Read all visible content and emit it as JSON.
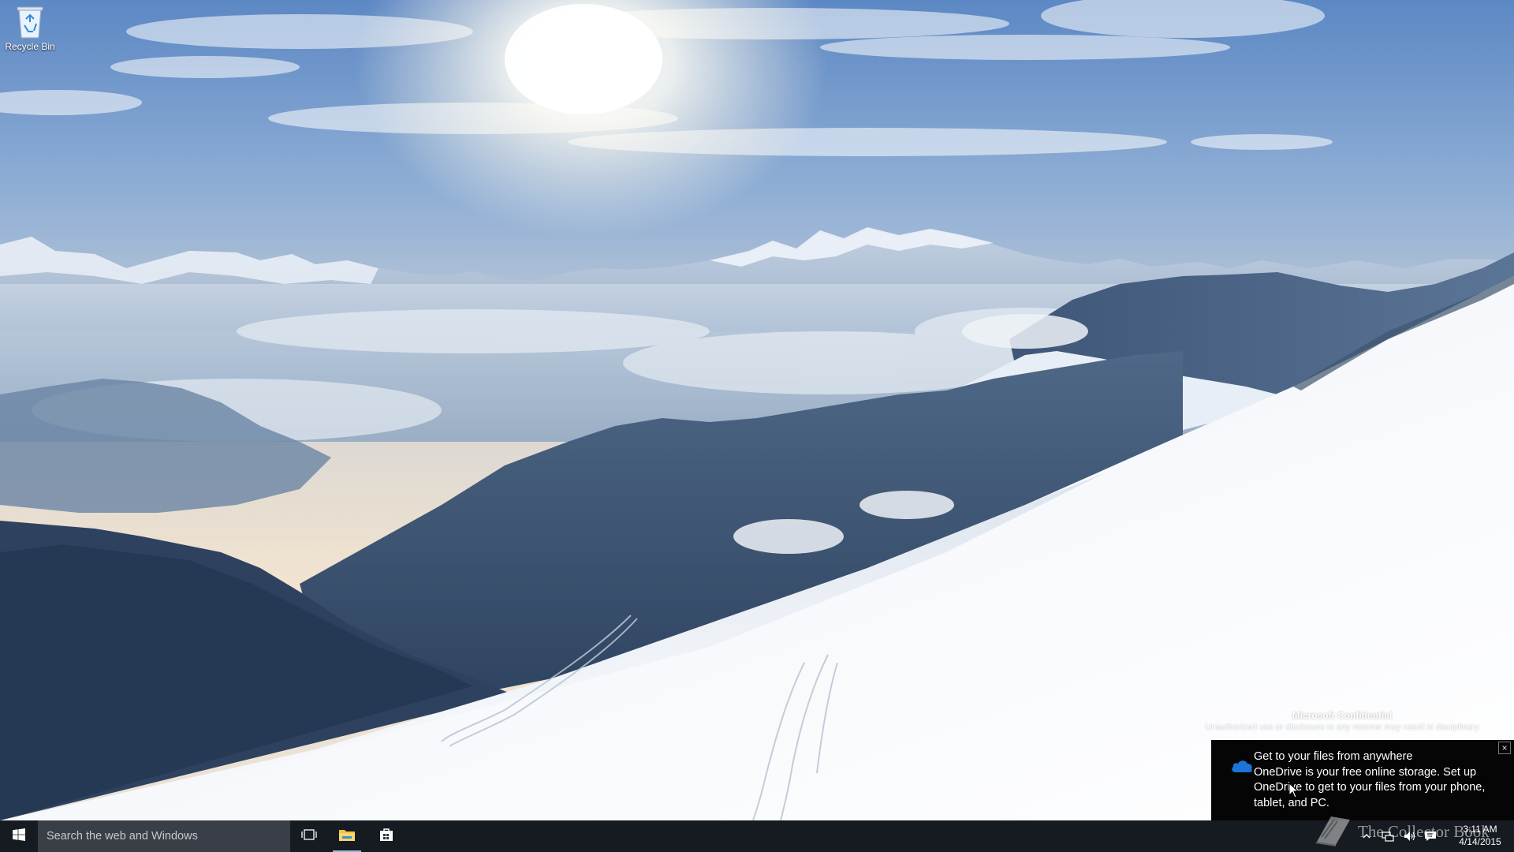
{
  "desktop": {
    "icons": [
      {
        "label": "Recycle Bin",
        "icon": "recycle-bin-icon"
      }
    ]
  },
  "watermark": {
    "title": "Microsoft Confidential",
    "body": "Unauthorized use or disclosure in any manner may result in disciplinary"
  },
  "toast": {
    "app_icon": "onedrive-cloud-icon",
    "heading": "Get to your files from anywhere",
    "body": "OneDrive is your free online storage. Set up OneDrive to get to your files from your phone, tablet, and PC.",
    "close_label": "×",
    "accent_color": "#1e73d8"
  },
  "taskbar": {
    "start_icon": "windows-logo-icon",
    "search_placeholder": "Search the web and Windows",
    "pinned": [
      {
        "name": "task-view",
        "icon": "task-view-icon"
      },
      {
        "name": "file-explorer",
        "icon": "folder-icon",
        "active": true
      },
      {
        "name": "store",
        "icon": "store-bag-icon"
      }
    ],
    "tray_icons": [
      "chevron-up-icon",
      "network-icon",
      "volume-icon",
      "action-center-icon"
    ],
    "clock": {
      "time": "3:11 AM",
      "date": "4/14/2015"
    }
  },
  "overlay": {
    "text": "The Collector Book"
  },
  "colors": {
    "taskbar_bg": "#12151b",
    "search_bg": "#3a3f47",
    "toast_bg": "#050505"
  }
}
